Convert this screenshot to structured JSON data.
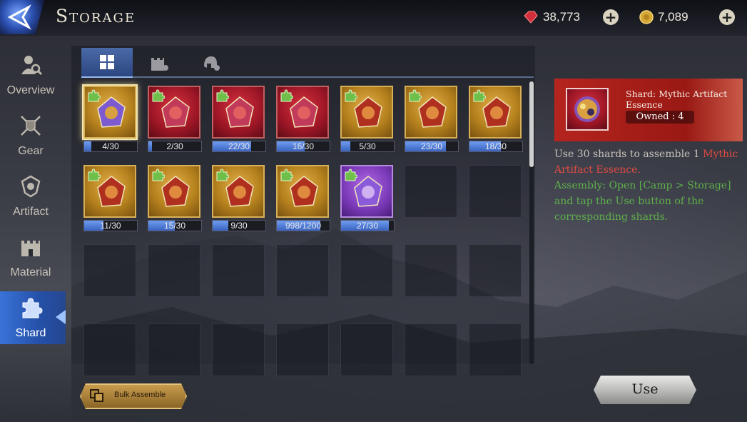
{
  "header": {
    "title": "Storage",
    "gems": {
      "icon": "ruby-gem-icon",
      "value": "38,773"
    },
    "gold": {
      "icon": "gold-coin-icon",
      "value": "7,089"
    }
  },
  "sidebar": {
    "items": [
      {
        "label": "Overview",
        "icon": "search-person-icon"
      },
      {
        "label": "Gear",
        "icon": "crossed-swords-shield-icon"
      },
      {
        "label": "Artifact",
        "icon": "crest-icon"
      },
      {
        "label": "Material",
        "icon": "castle-icon"
      },
      {
        "label": "Shard",
        "icon": "puzzle-piece-icon",
        "active": true
      }
    ]
  },
  "tabs": [
    {
      "icon": "grid-icon",
      "active": true
    },
    {
      "icon": "castle-gear-icon"
    },
    {
      "icon": "helmet-gear-icon"
    }
  ],
  "shards": [
    {
      "count": "4/30",
      "progress": 0.133,
      "rarity": "purple-gold",
      "selected": true
    },
    {
      "count": "2/30",
      "progress": 0.067,
      "rarity": "red"
    },
    {
      "count": "22/30",
      "progress": 0.733,
      "rarity": "red"
    },
    {
      "count": "16/30",
      "progress": 0.533,
      "rarity": "red"
    },
    {
      "count": "5/30",
      "progress": 0.167,
      "rarity": "gold"
    },
    {
      "count": "23/30",
      "progress": 0.767,
      "rarity": "gold"
    },
    {
      "count": "18/30",
      "progress": 0.6,
      "rarity": "gold"
    },
    {
      "count": "11/30",
      "progress": 0.367,
      "rarity": "gold"
    },
    {
      "count": "15/30",
      "progress": 0.5,
      "rarity": "gold"
    },
    {
      "count": "9/30",
      "progress": 0.3,
      "rarity": "gold"
    },
    {
      "count": "998/1200",
      "progress": 0.832,
      "rarity": "gold"
    },
    {
      "count": "27/30",
      "progress": 0.9,
      "rarity": "purple"
    }
  ],
  "bulk_label": "Bulk Assemble",
  "detail": {
    "name": "Shard: Mythic Artifact Essence",
    "owned": "Owned : 4",
    "desc_prefix": "Use 30 shards to assemble 1 ",
    "desc_highlight": "Mythic Artifact Essence.",
    "assembly": "Assembly: Open [Camp > Storage] and tap the Use button of the corresponding shards."
  },
  "use_label": "Use",
  "colors": {
    "accent_blue": "#3a73d8",
    "detail_red": "#b5241e",
    "highlight_red": "#e24b42",
    "assembly_green": "#5fb14b"
  }
}
